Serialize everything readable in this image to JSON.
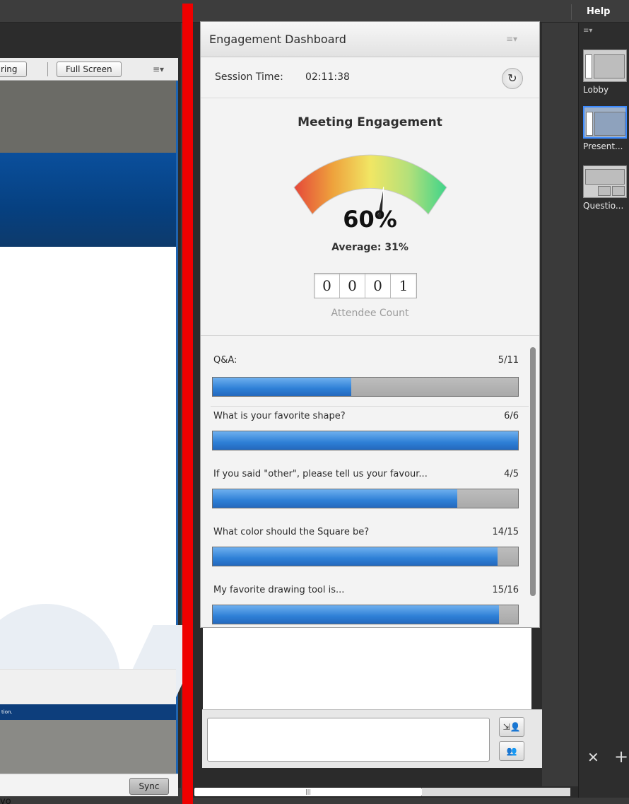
{
  "menu": {
    "help": "Help"
  },
  "share_pod": {
    "toolbar": {
      "partial_button": "ring",
      "fullscreen_button": "Full Screen"
    },
    "strip_text": "tion.",
    "link_text": "yo",
    "sync_button": "Sync"
  },
  "dashboard": {
    "title": "Engagement Dashboard",
    "session_label": "Session Time:",
    "session_time": "02:11:38",
    "engagement_title": "Meeting Engagement",
    "engagement_percent": "60%",
    "engagement_value": 60,
    "average": "Average: 31%",
    "attendee_digits": [
      "0",
      "0",
      "0",
      "1"
    ],
    "attendee_label": "Attendee Count",
    "questions": [
      {
        "label": "Q&A:",
        "count": "5/11",
        "answered": 5,
        "total": 11
      },
      {
        "label": "What is your favorite shape?",
        "count": "6/6",
        "answered": 6,
        "total": 6
      },
      {
        "label": "If you said \"other\", please tell us your favour...",
        "count": "4/5",
        "answered": 4,
        "total": 5
      },
      {
        "label": "What color should the Square be?",
        "count": "14/15",
        "answered": 14,
        "total": 15
      },
      {
        "label": "My favorite drawing tool is...",
        "count": "15/16",
        "answered": 15,
        "total": 16
      }
    ]
  },
  "layouts": {
    "items": [
      {
        "label": "Lobby"
      },
      {
        "label": "Present..."
      },
      {
        "label": "Questio..."
      }
    ]
  },
  "colors": {
    "accent": "#2e7fd6",
    "divider": "#ef0000"
  }
}
